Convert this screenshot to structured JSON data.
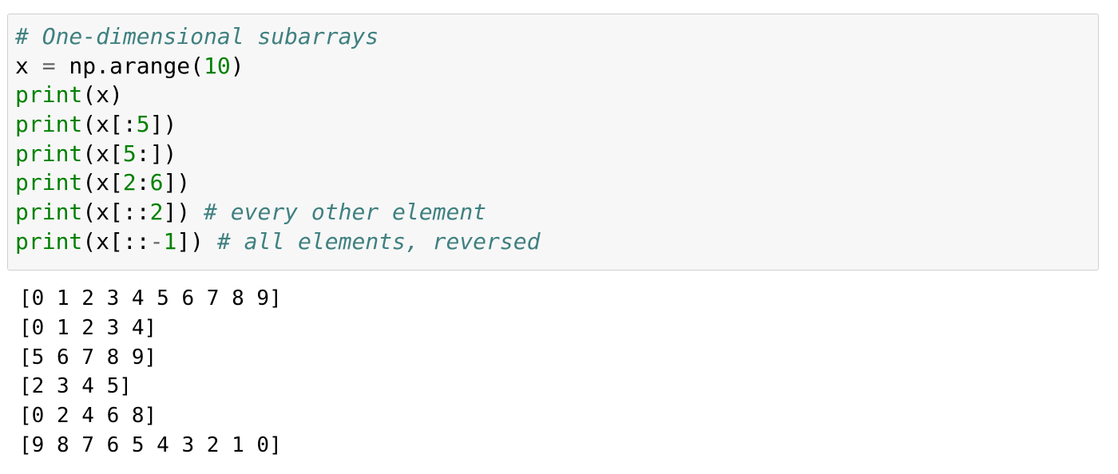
{
  "input_cell": {
    "lines": [
      [
        {
          "t": "# One-dimensional subarrays",
          "k": "comment"
        }
      ],
      [
        {
          "t": "x ",
          "k": "text"
        },
        {
          "t": "=",
          "k": "op"
        },
        {
          "t": " np.arange(",
          "k": "text"
        },
        {
          "t": "10",
          "k": "number"
        },
        {
          "t": ")",
          "k": "text"
        }
      ],
      [
        {
          "t": "print",
          "k": "builtin"
        },
        {
          "t": "(x)",
          "k": "text"
        }
      ],
      [
        {
          "t": "print",
          "k": "builtin"
        },
        {
          "t": "(x[:",
          "k": "text"
        },
        {
          "t": "5",
          "k": "number"
        },
        {
          "t": "])",
          "k": "text"
        }
      ],
      [
        {
          "t": "print",
          "k": "builtin"
        },
        {
          "t": "(x[",
          "k": "text"
        },
        {
          "t": "5",
          "k": "number"
        },
        {
          "t": ":])",
          "k": "text"
        }
      ],
      [
        {
          "t": "print",
          "k": "builtin"
        },
        {
          "t": "(x[",
          "k": "text"
        },
        {
          "t": "2",
          "k": "number"
        },
        {
          "t": ":",
          "k": "text"
        },
        {
          "t": "6",
          "k": "number"
        },
        {
          "t": "])",
          "k": "text"
        }
      ],
      [
        {
          "t": "print",
          "k": "builtin"
        },
        {
          "t": "(x[::",
          "k": "text"
        },
        {
          "t": "2",
          "k": "number"
        },
        {
          "t": "]) ",
          "k": "text"
        },
        {
          "t": "# every other element",
          "k": "comment"
        }
      ],
      [
        {
          "t": "print",
          "k": "builtin"
        },
        {
          "t": "(x[::",
          "k": "text"
        },
        {
          "t": "-",
          "k": "op"
        },
        {
          "t": "1",
          "k": "number"
        },
        {
          "t": "]) ",
          "k": "text"
        },
        {
          "t": "# all elements, reversed",
          "k": "comment"
        }
      ]
    ]
  },
  "output_cell": {
    "lines": [
      "[0 1 2 3 4 5 6 7 8 9]",
      "[0 1 2 3 4]",
      "[5 6 7 8 9]",
      "[2 3 4 5]",
      "[0 2 4 6 8]",
      "[9 8 7 6 5 4 3 2 1 0]"
    ]
  },
  "colors": {
    "cell_background": "#f7f7f7",
    "cell_border": "#cfcfcf",
    "comment": "#408080",
    "builtin": "#008000",
    "number": "#008000",
    "operator": "#666666",
    "text": "#000000"
  }
}
